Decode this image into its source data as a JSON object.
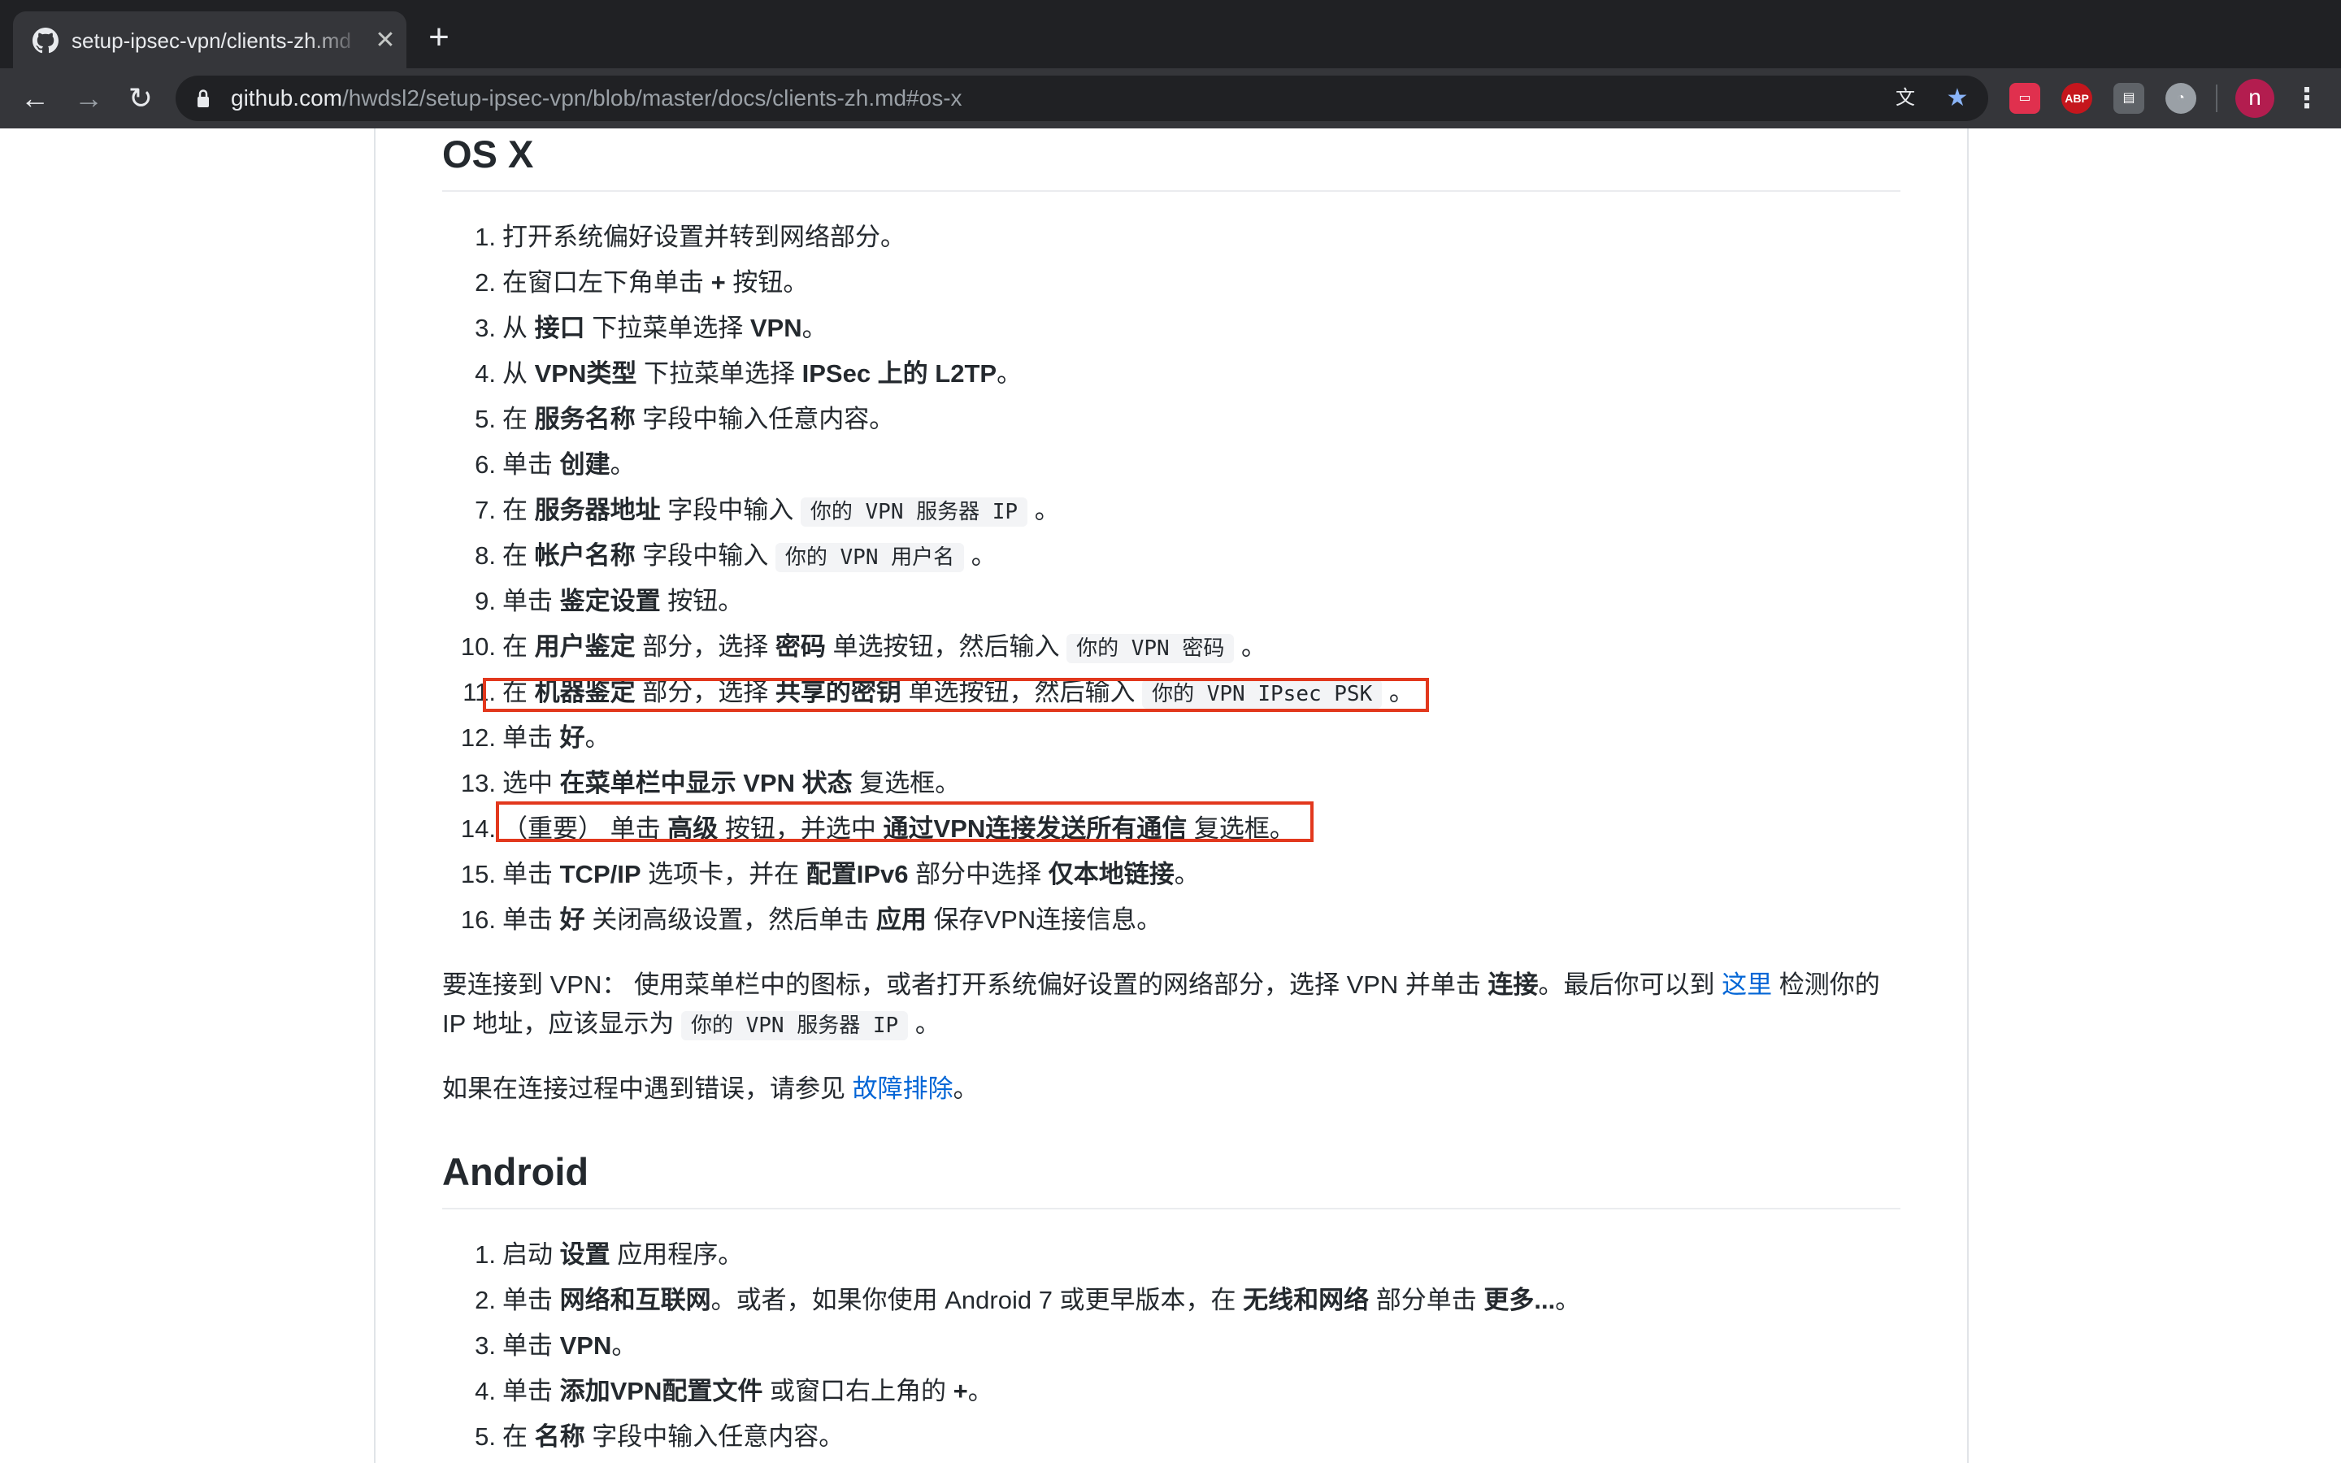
{
  "browser": {
    "tab_title": "setup-ipsec-vpn/clients-zh.md",
    "new_tab_label": "+",
    "url_host": "github.com",
    "url_path": "/hwdsl2/setup-ipsec-vpn/blob/master/docs/clients-zh.md#os-x",
    "ext_abp_label": "ABP",
    "avatar_letter": "n",
    "colors": {
      "tabstrip": "#202124",
      "toolbar": "#35363a",
      "star": "#8ab4f8",
      "highlight": "#e2381d",
      "link": "#0366d6"
    }
  },
  "osx": {
    "heading": "OS X",
    "steps": [
      {
        "n": "1.",
        "t1": "打开系统偏好设置并转到网络部分。"
      },
      {
        "n": "2.",
        "t1": "在窗口左下角单击 ",
        "b1": "+",
        "t2": " 按钮。"
      },
      {
        "n": "3.",
        "t1": "从 ",
        "b1": "接口",
        "t2": " 下拉菜单选择 ",
        "b2": "VPN",
        "t3": "。"
      },
      {
        "n": "4.",
        "t1": "从 ",
        "b1": "VPN类型",
        "t2": " 下拉菜单选择 ",
        "b2": "IPSec 上的 L2TP",
        "t3": "。"
      },
      {
        "n": "5.",
        "t1": "在 ",
        "b1": "服务名称",
        "t2": " 字段中输入任意内容。"
      },
      {
        "n": "6.",
        "t1": "单击 ",
        "b1": "创建",
        "t2": "。"
      },
      {
        "n": "7.",
        "t1": "在 ",
        "b1": "服务器地址",
        "t2": " 字段中输入 ",
        "c1": "你的 VPN 服务器 IP",
        "t3": " 。"
      },
      {
        "n": "8.",
        "t1": "在 ",
        "b1": "帐户名称",
        "t2": " 字段中输入 ",
        "c1": "你的 VPN 用户名",
        "t3": " 。"
      },
      {
        "n": "9.",
        "t1": "单击 ",
        "b1": "鉴定设置",
        "t2": " 按钮。"
      },
      {
        "n": "10.",
        "t1": "在 ",
        "b1": "用户鉴定",
        "t2": " 部分，选择 ",
        "b2": "密码",
        "t3": " 单选按钮，然后输入 ",
        "c1": "你的 VPN 密码",
        "t4": " 。"
      },
      {
        "n": "11.",
        "t1": "在 ",
        "b1": "机器鉴定",
        "t2": " 部分，选择 ",
        "b2": "共享的密钥",
        "t3": " 单选按钮，然后输入 ",
        "c1": "你的 VPN IPsec PSK",
        "t4": " 。"
      },
      {
        "n": "12.",
        "t1": "单击 ",
        "b1": "好",
        "t2": "。"
      },
      {
        "n": "13.",
        "t1": "选中 ",
        "b1": "在菜单栏中显示 VPN 状态",
        "t2": " 复选框。"
      },
      {
        "n": "14.",
        "t1": "（重要） 单击 ",
        "b1": "高级",
        "t2": " 按钮，并选中 ",
        "b2": "通过VPN连接发送所有通信",
        "t3": " 复选框。"
      },
      {
        "n": "15.",
        "t1": "单击 ",
        "b1": "TCP/IP",
        "t2": " 选项卡，并在 ",
        "b2": "配置IPv6",
        "t3": " 部分中选择 ",
        "b3": "仅本地链接",
        "t4": "。"
      },
      {
        "n": "16.",
        "t1": "单击 ",
        "b1": "好",
        "t2": " 关闭高级设置，然后单击 ",
        "b2": "应用",
        "t3": " 保存VPN连接信息。"
      }
    ],
    "connect_para": {
      "t1": "要连接到 VPN： 使用菜单栏中的图标，或者打开系统偏好设置的网络部分，选择 VPN 并单击 ",
      "b1": "连接",
      "t2": "。最后你可以到 ",
      "link": "这里",
      "t3": " 检测你的 IP 地址，应该显示为 ",
      "c1": "你的 VPN 服务器 IP",
      "t4": " 。"
    },
    "trouble_para": {
      "t1": "如果在连接过程中遇到错误，请参见 ",
      "link": "故障排除",
      "t2": "。"
    }
  },
  "android": {
    "heading": "Android",
    "steps": [
      {
        "n": "1.",
        "t1": "启动 ",
        "b1": "设置",
        "t2": " 应用程序。"
      },
      {
        "n": "2.",
        "t1": "单击 ",
        "b1": "网络和互联网",
        "t2": "。或者，如果你使用 Android 7 或更早版本，在 ",
        "b2": "无线和网络",
        "t3": " 部分单击 ",
        "b3": "更多...",
        "t4": "。"
      },
      {
        "n": "3.",
        "t1": "单击 ",
        "b1": "VPN",
        "t2": "。"
      },
      {
        "n": "4.",
        "t1": "单击 ",
        "b1": "添加VPN配置文件",
        "t2": " 或窗口右上角的 ",
        "b2": "+",
        "t3": "。"
      },
      {
        "n": "5.",
        "t1": "在 ",
        "b1": "名称",
        "t2": " 字段中输入任意内容。"
      }
    ]
  }
}
